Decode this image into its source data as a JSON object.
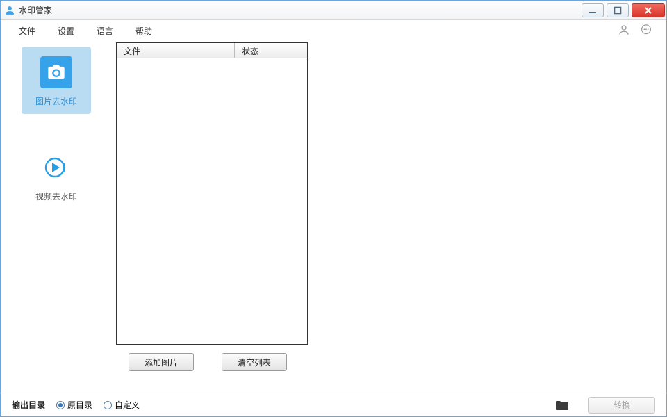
{
  "window": {
    "title": "水印管家"
  },
  "menu": {
    "file": "文件",
    "settings": "设置",
    "language": "语言",
    "help": "帮助"
  },
  "sidebar": {
    "image_watermark": "图片去水印",
    "video_watermark": "视频去水印"
  },
  "table": {
    "col_file": "文件",
    "col_status": "状态"
  },
  "actions": {
    "add_image": "添加图片",
    "clear_list": "清空列表"
  },
  "footer": {
    "output_dir_label": "输出目录",
    "opt_original": "原目录",
    "opt_custom": "自定义",
    "convert": "转换"
  }
}
